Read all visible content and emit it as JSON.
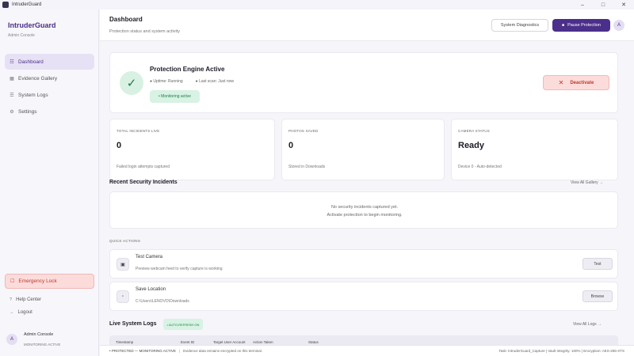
{
  "window": {
    "title": "IntruderGuard"
  },
  "sidebar": {
    "brand": "IntruderGuard",
    "subtitle": "Admin Console",
    "items": [
      {
        "label": "Dashboard",
        "icon": "grid-icon",
        "active": true
      },
      {
        "label": "Evidence Gallery",
        "icon": "image-icon",
        "active": false
      },
      {
        "label": "System Logs",
        "icon": "list-icon",
        "active": false
      },
      {
        "label": "Settings",
        "icon": "gear-icon",
        "active": false
      }
    ],
    "emergency_label": "Emergency Lock",
    "help_label": "Help Center",
    "logout_label": "Logout",
    "profile": {
      "avatar": "A",
      "name": "Admin Console",
      "status": "MONITORING ACTIVE"
    }
  },
  "header": {
    "title": "Dashboard",
    "subtitle": "Protection status and system activity",
    "diagnostics_label": "System Diagnostics",
    "pause_label": "Pause Protection",
    "avatar": "A"
  },
  "engine": {
    "title": "Protection Engine Active",
    "uptime": "Uptime: Running",
    "last_scan": "Last scan: Just now",
    "chip": "• Monitoring active",
    "deactivate_label": "Deactivate"
  },
  "stats": [
    {
      "label": "TOTAL INCIDENTS LIVE",
      "value": "0",
      "desc": "Failed login attempts captured"
    },
    {
      "label": "PHOTOS SAVED",
      "value": "0",
      "desc": "Stored in Downloads"
    },
    {
      "label": "CAMERA STATUS",
      "value": "Ready",
      "desc": "Device 0 - Auto-detected"
    }
  ],
  "incidents": {
    "title": "Recent Security Incidents",
    "view_all": "View All Gallery →",
    "empty_line1": "No security incidents captured yet.",
    "empty_line2": "Activate protection to begin monitoring."
  },
  "quick_actions": {
    "label": "QUICK ACTIONS",
    "items": [
      {
        "title": "Test Camera",
        "desc": "Preview webcam feed to verify capture is working",
        "button": "Test",
        "icon": "camera-icon"
      },
      {
        "title": "Save Location",
        "desc": "C:\\Users\\LENOVO\\Downloads",
        "button": "Browse",
        "icon": "folder-icon"
      }
    ]
  },
  "logs": {
    "title": "Live System Logs",
    "chip": "• AUTO-REFRESH ON",
    "view_all": "View All Logs →",
    "columns": [
      "Timestamp",
      "Event ID",
      "Target User Account",
      "Action Taken",
      "Status"
    ]
  },
  "statusbar": {
    "state": "• PROTECTED — MONITORING ACTIVE",
    "note": "Evidence data remains encrypted on this terminal.",
    "right": "Task: IntruderGuard_Capture | Vault Integrity: 100% | Encryption: AES-256-XTS"
  },
  "colors": {
    "accent": "#4b2f8a",
    "success": "#1e7b4a",
    "danger": "#c0392b"
  }
}
